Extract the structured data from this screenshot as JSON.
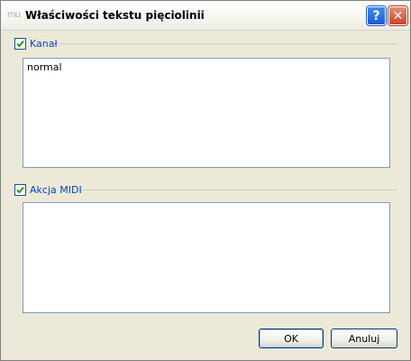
{
  "window": {
    "title": "Właściwości tekstu pięciolinii",
    "app_icon_text": "mu"
  },
  "titlebar_buttons": {
    "help_label": "?",
    "close_label": "✕"
  },
  "groups": {
    "channel": {
      "label": "Kanał",
      "checked": true,
      "text": "normal"
    },
    "midi_action": {
      "label": "Akcja MIDI",
      "checked": true,
      "text": ""
    }
  },
  "buttons": {
    "ok_label": "OK",
    "cancel_label": "Anuluj"
  },
  "colors": {
    "group_label": "#0046d5",
    "checkmark": "#21a121"
  },
  "icons": {
    "app": "musescore-icon",
    "help": "help-icon",
    "close": "close-icon",
    "check": "checkmark-icon"
  }
}
